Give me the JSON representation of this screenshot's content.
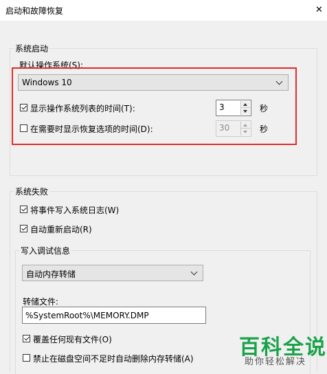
{
  "window": {
    "title": "启动和故障恢复"
  },
  "startup": {
    "legend": "系统启动",
    "default_os_label": "默认操作系统(S):",
    "default_os_value": "Windows 10",
    "show_list_label": "显示操作系统列表的时间(T):",
    "show_list_checked": true,
    "show_list_value": "3",
    "show_recovery_label": "在需要时显示恢复选项的时间(D):",
    "show_recovery_checked": false,
    "show_recovery_value": "30",
    "seconds_unit": "秒"
  },
  "failure": {
    "legend": "系统失败",
    "write_event_label": "将事件写入系统日志(W)",
    "write_event_checked": true,
    "auto_restart_label": "自动重新启动(R)",
    "auto_restart_checked": true
  },
  "debug": {
    "legend": "写入调试信息",
    "dump_type_value": "自动内存转储",
    "dump_file_label": "转储文件:",
    "dump_file_value": "%SystemRoot%\\MEMORY.DMP",
    "overwrite_label": "覆盖任何现有文件(O)",
    "overwrite_checked": true,
    "disable_autodelete_label": "禁止在磁盘空间不足时自动删除内存转储(A)",
    "disable_autodelete_checked": false
  },
  "watermark": {
    "main": "百科全说",
    "sub": "助你轻松解决"
  },
  "colors": {
    "highlight": "#e32b2b",
    "watermark": "#1aa24b"
  }
}
